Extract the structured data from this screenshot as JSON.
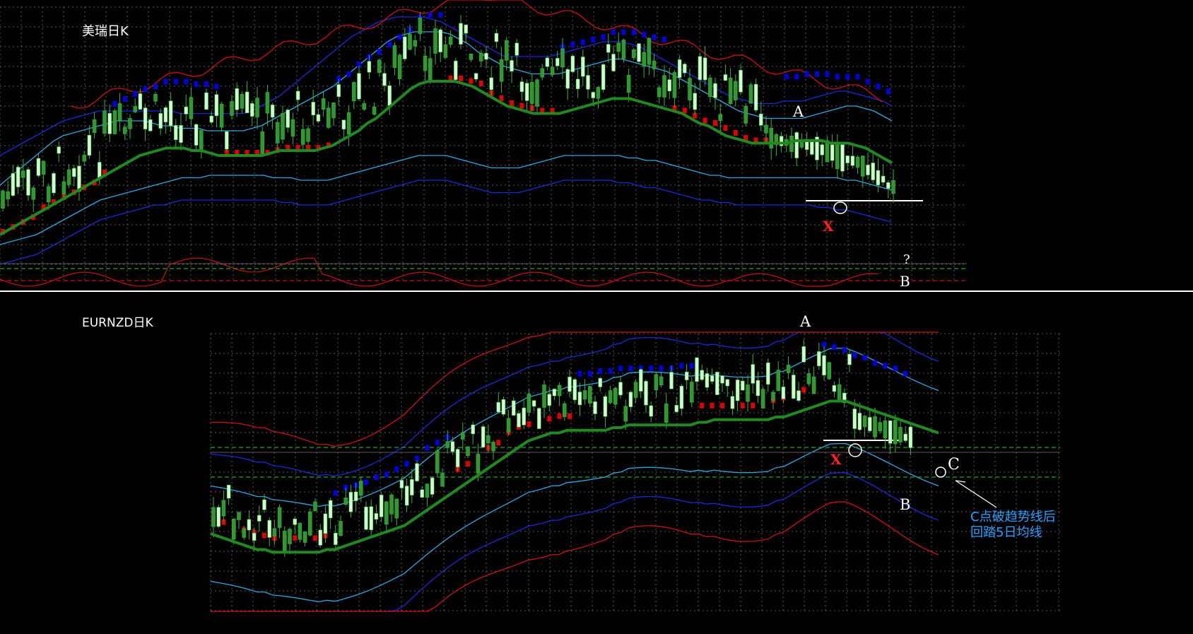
{
  "colors": {
    "background": "#000000",
    "grid": "#5a5a5a",
    "separator": "#ffffff",
    "bull_candle": "#ccffcc",
    "bear_candle": "#2e9a2e",
    "wick": "#3ab33a",
    "ma": "#1f8a1f",
    "sar_up": "#e00000",
    "sar_down": "#0000e0",
    "band_inner": "#2fa8e0",
    "band_middle": "#1a2ad8",
    "band_outer": "#cc1111",
    "support_line": "#22aa22",
    "label": "#ffffff",
    "marker_x": "#ff2020",
    "note": "#2aa0ff"
  },
  "chart_data": [
    {
      "type": "candlestick",
      "title": "美瑞日K",
      "description_only": false,
      "y_range": [
        0,
        100
      ],
      "series": [
        {
          "name": "",
          "role": "ma",
          "values": [
            8,
            10,
            12,
            14,
            16,
            18,
            20,
            22,
            24,
            26,
            28,
            30,
            32,
            34,
            36,
            38,
            40,
            41,
            42,
            43,
            43,
            43,
            42,
            42,
            41,
            40,
            40,
            40,
            40,
            40,
            40,
            41,
            42,
            42,
            42,
            42,
            42,
            43,
            44,
            46,
            48,
            50,
            53,
            55,
            58,
            61,
            64,
            67,
            69,
            70,
            70,
            70,
            70,
            69,
            68,
            66,
            64,
            62,
            60,
            59,
            58,
            57,
            57,
            57,
            57,
            58,
            59,
            60,
            61,
            62,
            63,
            63,
            63,
            62,
            61,
            60,
            59,
            58,
            57,
            55,
            53,
            52,
            50,
            48,
            47,
            46,
            45,
            45,
            45,
            45,
            45,
            46,
            46,
            46,
            46,
            45,
            45,
            45,
            44,
            43,
            41,
            39,
            37
          ]
        },
        {
          "name": "",
          "role": "inner_upper",
          "values": [
            28,
            31,
            34,
            37,
            40,
            43,
            46,
            48,
            49,
            50,
            51,
            52,
            53,
            54,
            54,
            54,
            54,
            53,
            52,
            52,
            51,
            51,
            51,
            50,
            50,
            50,
            50,
            50,
            51,
            52,
            54,
            56,
            58,
            60,
            62,
            64,
            66,
            68,
            71,
            74,
            77,
            80,
            83,
            86,
            88,
            89,
            90,
            90,
            90,
            90,
            89,
            87,
            85,
            82,
            80,
            78,
            76,
            75,
            74,
            73,
            73,
            73,
            73,
            74,
            75,
            76,
            77,
            78,
            79,
            79,
            78,
            77,
            76,
            75,
            74,
            72,
            70,
            68,
            66,
            64,
            62,
            60,
            58,
            57,
            56,
            55,
            55,
            55,
            55,
            55,
            56,
            57,
            58,
            59,
            60,
            60,
            59,
            58,
            56,
            54
          ]
        },
        {
          "name": "",
          "role": "inner_lower",
          "values": [
            4,
            5,
            6,
            7,
            8,
            10,
            12,
            14,
            16,
            18,
            20,
            22,
            23,
            24,
            25,
            26,
            27,
            28,
            29,
            30,
            31,
            31,
            31,
            32,
            32,
            32,
            32,
            32,
            32,
            32,
            31,
            31,
            31,
            30,
            30,
            30,
            30,
            31,
            32,
            33,
            34,
            35,
            36,
            37,
            38,
            39,
            40,
            40,
            40,
            40,
            39,
            38,
            37,
            36,
            35,
            35,
            35,
            35,
            36,
            37,
            38,
            39,
            40,
            40,
            40,
            40,
            40,
            40,
            40,
            39,
            39,
            38,
            38,
            37,
            36,
            35,
            34,
            33,
            32,
            32,
            31,
            31,
            31,
            31,
            31,
            31,
            31,
            31,
            31,
            31,
            31,
            31,
            31,
            30,
            30,
            29,
            28,
            27,
            26
          ]
        },
        {
          "name": "",
          "role": "middle_upper",
          "values": [
            40,
            42,
            44,
            46,
            48,
            50,
            52,
            54,
            55,
            56,
            57,
            58,
            58,
            58,
            58,
            58,
            58,
            58,
            58,
            58,
            57,
            57,
            57,
            57,
            57,
            57,
            57,
            57,
            58,
            60,
            62,
            64,
            67,
            70,
            73,
            76,
            79,
            82,
            85,
            88,
            90,
            92,
            94,
            95,
            96,
            96,
            96,
            96,
            95,
            94,
            92,
            90,
            88,
            86,
            84,
            82,
            80,
            80,
            80,
            80,
            80,
            80,
            81,
            82,
            83,
            84,
            85,
            86,
            86,
            86,
            85,
            84,
            82,
            80,
            78,
            76,
            74,
            72,
            70,
            68,
            66,
            64,
            63,
            62,
            61,
            61,
            61,
            62,
            62,
            62,
            63,
            64,
            65,
            66,
            66,
            65,
            64,
            63,
            62,
            60
          ]
        },
        {
          "name": "",
          "role": "middle_lower",
          "values": [
            -4,
            -3,
            -2,
            -1,
            0,
            2,
            4,
            6,
            8,
            10,
            12,
            14,
            15,
            16,
            17,
            18,
            19,
            20,
            20,
            21,
            22,
            22,
            22,
            22,
            22,
            22,
            22,
            22,
            22,
            22,
            22,
            21,
            21,
            20,
            20,
            20,
            20,
            21,
            22,
            23,
            24,
            25,
            26,
            27,
            28,
            29,
            30,
            30,
            30,
            30,
            29,
            28,
            27,
            26,
            25,
            25,
            25,
            25,
            26,
            27,
            28,
            29,
            30,
            30,
            30,
            30,
            30,
            30,
            29,
            29,
            28,
            27,
            27,
            26,
            25,
            24,
            23,
            22,
            22,
            21,
            21,
            20,
            20,
            20,
            20,
            20,
            20,
            20,
            20,
            20,
            19,
            19,
            18,
            18,
            17,
            16,
            15,
            14,
            13
          ]
        }
      ]
    },
    {
      "type": "candlestick",
      "title": "EURNZD日K",
      "description_only": false,
      "y_range": [
        0,
        100
      ],
      "series": [
        {
          "name": "",
          "role": "ma",
          "values": [
            24,
            23,
            22,
            21,
            20,
            19,
            18,
            18,
            17,
            17,
            17,
            17,
            17,
            17,
            17,
            18,
            18,
            19,
            20,
            21,
            22,
            23,
            24,
            25,
            26,
            27,
            29,
            31,
            33,
            35,
            37,
            39,
            41,
            43,
            45,
            47,
            49,
            51,
            53,
            55,
            57,
            59,
            60,
            61,
            62,
            62,
            63,
            63,
            63,
            63,
            63,
            63,
            64,
            64,
            65,
            65,
            65,
            65,
            65,
            65,
            65,
            65,
            65,
            66,
            66,
            67,
            67,
            67,
            67,
            67,
            67,
            67,
            67,
            68,
            68,
            69,
            70,
            71,
            72,
            73,
            74,
            74,
            74,
            73,
            72,
            71,
            70,
            69,
            68,
            67,
            66,
            65,
            64,
            63,
            62
          ]
        }
      ]
    }
  ],
  "annotations": {
    "top": {
      "label_a": "A",
      "label_b": "B",
      "question": "?",
      "marker_x": "X"
    },
    "bottom": {
      "label_a": "A",
      "label_b": "B",
      "label_c": "C",
      "marker_x": "X",
      "note_line_1": "C点破趋势线后",
      "note_line_2": "回踏5日均线"
    }
  }
}
